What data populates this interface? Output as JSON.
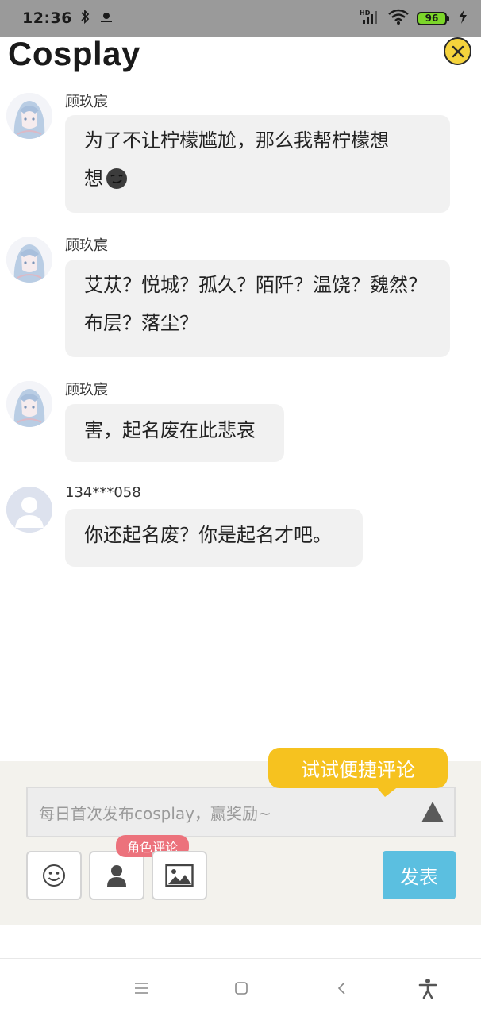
{
  "status_bar": {
    "time": "12:36",
    "battery": "96",
    "icons": [
      "bluetooth-icon",
      "app-notification-icon",
      "hd-signal-icon",
      "wifi-icon",
      "battery-icon",
      "charging-icon"
    ]
  },
  "header": {
    "title": "Cosplay",
    "close_icon": "close-icon"
  },
  "messages": [
    {
      "username": "顾玖宸",
      "line1": "为了不让柠檬尴尬，那么我帮柠檬想",
      "line2": "想",
      "emoji": "smirk-moon-emoji",
      "avatar": "anime-avatar"
    },
    {
      "username": "顾玖宸",
      "line1": "艾苁？悦城？孤久？陌阡？温饶？魏然？",
      "line2": "布层？落尘？",
      "avatar": "anime-avatar"
    },
    {
      "username": "顾玖宸",
      "line1": "害，起名废在此悲哀",
      "avatar": "anime-avatar"
    },
    {
      "username": "134***058",
      "line1": "你还起名废？你是起名才吧。",
      "avatar": "default-user-avatar"
    }
  ],
  "comment": {
    "tooltip": "试试便捷评论",
    "placeholder": "每日首次发布cosplay，赢奖励~",
    "role_badge": "角色评论",
    "post_label": "发表",
    "tools": [
      "emoji-icon",
      "role-icon",
      "image-icon"
    ]
  },
  "colors": {
    "status_bar": "#9a9a9a",
    "bubble": "#f1f1f1",
    "tooltip": "#f6c21f",
    "post_button": "#5bbfe0",
    "role_badge": "#ec727c",
    "panel": "#f3f2ed"
  },
  "nav_bar": {
    "icons": [
      "menu-icon",
      "home-icon",
      "back-icon",
      "accessibility-icon"
    ]
  }
}
